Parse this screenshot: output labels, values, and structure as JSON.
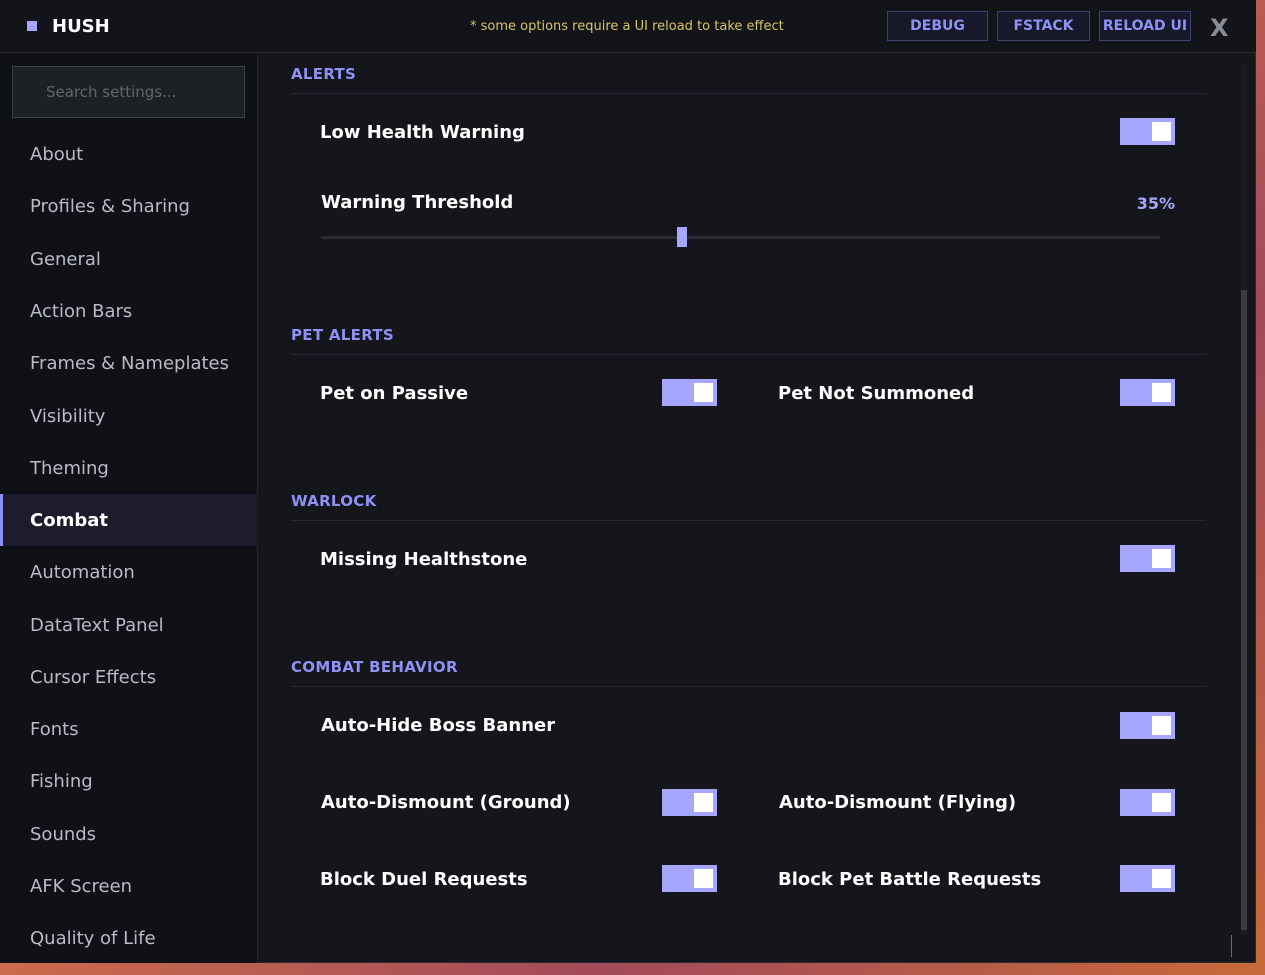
{
  "app": {
    "title": "HUSH",
    "notice": "* some options require a UI reload to take effect"
  },
  "toolbar": {
    "debug_label": "DEBUG",
    "fstack_label": "FSTACK",
    "reload_label": "RELOAD UI",
    "close_label": "X"
  },
  "search": {
    "placeholder": "Search settings..."
  },
  "sidebar": {
    "items": [
      {
        "label": "About"
      },
      {
        "label": "Profiles & Sharing"
      },
      {
        "label": "General"
      },
      {
        "label": "Action Bars"
      },
      {
        "label": "Frames & Nameplates"
      },
      {
        "label": "Visibility"
      },
      {
        "label": "Theming"
      },
      {
        "label": "Combat",
        "active": true
      },
      {
        "label": "Automation"
      },
      {
        "label": "DataText Panel"
      },
      {
        "label": "Cursor Effects"
      },
      {
        "label": "Fonts"
      },
      {
        "label": "Fishing"
      },
      {
        "label": "Sounds"
      },
      {
        "label": "AFK Screen"
      },
      {
        "label": "Quality of Life"
      }
    ]
  },
  "sections": {
    "alerts": {
      "title": "ALERTS",
      "low_health_warning": {
        "label": "Low Health Warning",
        "enabled": true
      },
      "warning_threshold": {
        "label": "Warning Threshold",
        "value": "35%",
        "fraction": 0.43
      }
    },
    "pet_alerts": {
      "title": "PET ALERTS",
      "pet_on_passive": {
        "label": "Pet on Passive",
        "enabled": true
      },
      "pet_not_summoned": {
        "label": "Pet Not Summoned",
        "enabled": true
      }
    },
    "warlock": {
      "title": "WARLOCK",
      "missing_healthstone": {
        "label": "Missing Healthstone",
        "enabled": true
      }
    },
    "combat_behavior": {
      "title": "COMBAT BEHAVIOR",
      "auto_hide_boss_banner": {
        "label": "Auto-Hide Boss Banner",
        "enabled": true
      },
      "auto_dismount_ground": {
        "label": "Auto-Dismount (Ground)",
        "enabled": true
      },
      "auto_dismount_flying": {
        "label": "Auto-Dismount (Flying)",
        "enabled": true
      },
      "block_duel_requests": {
        "label": "Block Duel Requests",
        "enabled": true
      },
      "block_pet_battle_requests": {
        "label": "Block Pet Battle Requests",
        "enabled": true
      }
    }
  },
  "colors": {
    "accent": "#a6a6ff",
    "heading": "#8f92f5",
    "notice": "#d4c56a",
    "background": "#15161b"
  }
}
